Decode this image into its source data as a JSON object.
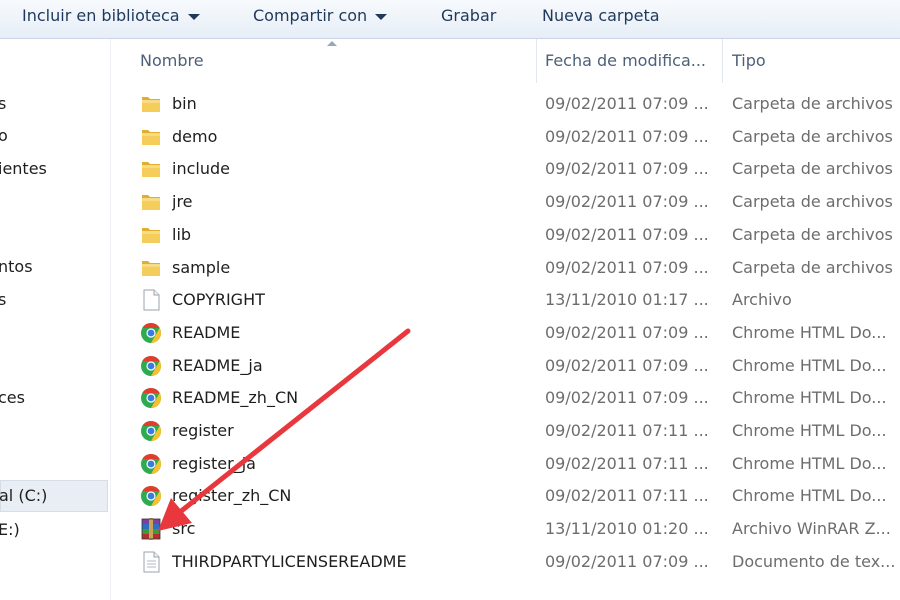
{
  "toolbar": {
    "include_library": "Incluir en biblioteca",
    "share_with": "Compartir con",
    "burn": "Grabar",
    "new_folder": "Nueva carpeta"
  },
  "nav": {
    "items": [
      "s",
      "o",
      "ientes",
      "ntos",
      "s",
      "ces",
      "al (C:)",
      "E:)"
    ]
  },
  "columns": {
    "name": "Nombre",
    "date": "Fecha de modifica...",
    "type": "Tipo"
  },
  "files": [
    {
      "name": "bin",
      "date": "09/02/2011 07:09 ...",
      "type": "Carpeta de archivos",
      "icon": "folder-icon"
    },
    {
      "name": "demo",
      "date": "09/02/2011 07:09 ...",
      "type": "Carpeta de archivos",
      "icon": "folder-icon"
    },
    {
      "name": "include",
      "date": "09/02/2011 07:09 ...",
      "type": "Carpeta de archivos",
      "icon": "folder-icon"
    },
    {
      "name": "jre",
      "date": "09/02/2011 07:09 ...",
      "type": "Carpeta de archivos",
      "icon": "folder-icon"
    },
    {
      "name": "lib",
      "date": "09/02/2011 07:09 ...",
      "type": "Carpeta de archivos",
      "icon": "folder-icon"
    },
    {
      "name": "sample",
      "date": "09/02/2011 07:09 ...",
      "type": "Carpeta de archivos",
      "icon": "folder-icon"
    },
    {
      "name": "COPYRIGHT",
      "date": "13/11/2010 01:17 ...",
      "type": "Archivo",
      "icon": "blank-file-icon"
    },
    {
      "name": "README",
      "date": "09/02/2011 07:09 ...",
      "type": "Chrome HTML Do...",
      "icon": "chrome-icon"
    },
    {
      "name": "README_ja",
      "date": "09/02/2011 07:09 ...",
      "type": "Chrome HTML Do...",
      "icon": "chrome-icon"
    },
    {
      "name": "README_zh_CN",
      "date": "09/02/2011 07:09 ...",
      "type": "Chrome HTML Do...",
      "icon": "chrome-icon"
    },
    {
      "name": "register",
      "date": "09/02/2011 07:11 ...",
      "type": "Chrome HTML Do...",
      "icon": "chrome-icon"
    },
    {
      "name": "register_ja",
      "date": "09/02/2011 07:11 ...",
      "type": "Chrome HTML Do...",
      "icon": "chrome-icon"
    },
    {
      "name": "register_zh_CN",
      "date": "09/02/2011 07:11 ...",
      "type": "Chrome HTML Do...",
      "icon": "chrome-icon"
    },
    {
      "name": "src",
      "date": "13/11/2010 01:20 ...",
      "type": "Archivo WinRAR Z...",
      "icon": "winrar-archive-icon"
    },
    {
      "name": "THIRDPARTYLICENSEREADME",
      "date": "09/02/2011 07:09 ...",
      "type": "Documento de tex...",
      "icon": "text-document-icon"
    }
  ],
  "colors": {
    "toolbar_text": "#1e395b",
    "header_text": "#4c607a",
    "secondary_text": "#6d6d6d",
    "arrow": "#e8383d",
    "folder": "#f3c64a"
  }
}
